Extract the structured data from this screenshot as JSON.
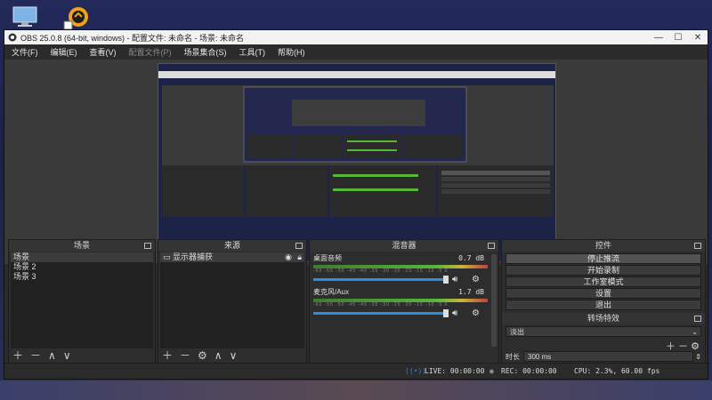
{
  "window": {
    "title": "OBS 25.0.8 (64-bit, windows) - 配置文件: 未命名 - 场景: 未命名",
    "controls": {
      "minimize": "—",
      "maximize": "☐",
      "close": "✕"
    }
  },
  "menu": [
    "文件(F)",
    "编辑(E)",
    "查看(V)",
    "配置文件(P)",
    "场景集合(S)",
    "工具(T)",
    "帮助(H)"
  ],
  "scenes": {
    "title": "场景",
    "items": [
      "场景",
      "场景 2",
      "场景 3"
    ],
    "selected_index": 0
  },
  "sources": {
    "title": "来源",
    "items": [
      {
        "label": "显示器捕获",
        "visible": true,
        "locked": true
      }
    ]
  },
  "mixer": {
    "title": "混音器",
    "tracks": [
      {
        "name": "桌面音频",
        "db": "0.7 dB",
        "volume_fraction": 0.98
      },
      {
        "name": "麦克风/Aux",
        "db": "1.7 dB",
        "volume_fraction": 0.98
      }
    ],
    "ticks": "-60 -55 -50 -45 -40 -35 -30 -25 -20 -15 -10 -5 0"
  },
  "controls": {
    "title": "控件",
    "buttons": [
      "停止推流",
      "开始录制",
      "工作室模式",
      "设置",
      "退出"
    ],
    "active_button_index": 0,
    "transition_title": "转场特效",
    "transition_value": "淡出",
    "duration_label": "时长",
    "duration_value": "300 ms"
  },
  "status": {
    "live": "LIVE: 00:00:00",
    "rec": "REC: 00:00:00",
    "cpu": "CPU: 2.3%, 60.00 fps"
  },
  "colors": {
    "accent": "#2c8de0",
    "live_icon": "#3a7bd5",
    "meter_green": "#55b63a"
  }
}
